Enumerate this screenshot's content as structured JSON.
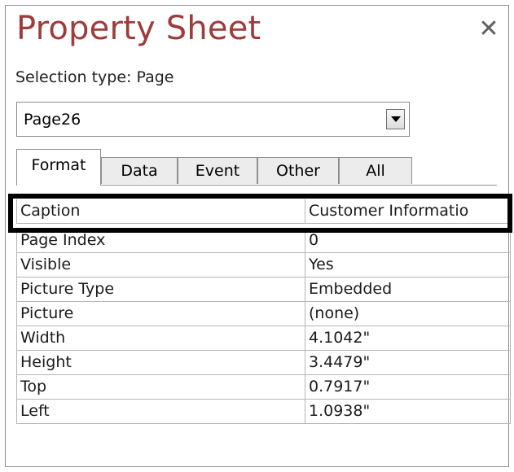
{
  "window": {
    "title": "Property Sheet",
    "close_glyph": "✕",
    "icon_close": "close-icon"
  },
  "selection": {
    "label": "Selection type:",
    "type": "Page"
  },
  "selector": {
    "value": "Page26",
    "icon_dropdown": "chevron-down-icon"
  },
  "tabs": [
    {
      "label": "Format",
      "active": true
    },
    {
      "label": "Data",
      "active": false
    },
    {
      "label": "Event",
      "active": false
    },
    {
      "label": "Other",
      "active": false
    },
    {
      "label": "All",
      "active": false
    }
  ],
  "properties": [
    {
      "name": "Caption",
      "value": "Customer Informatio",
      "highlighted": true
    },
    {
      "name": "Page Index",
      "value": "0"
    },
    {
      "name": "Visible",
      "value": "Yes"
    },
    {
      "name": "Picture Type",
      "value": "Embedded"
    },
    {
      "name": "Picture",
      "value": "(none)"
    },
    {
      "name": "Width",
      "value": "4.1042\""
    },
    {
      "name": "Height",
      "value": "3.4479\""
    },
    {
      "name": "Top",
      "value": "0.7917\""
    },
    {
      "name": "Left",
      "value": "1.0938\""
    }
  ],
  "colors": {
    "title": "#9e3b3b",
    "highlight_border": "#000000",
    "grid_line": "#b5b5b5"
  }
}
